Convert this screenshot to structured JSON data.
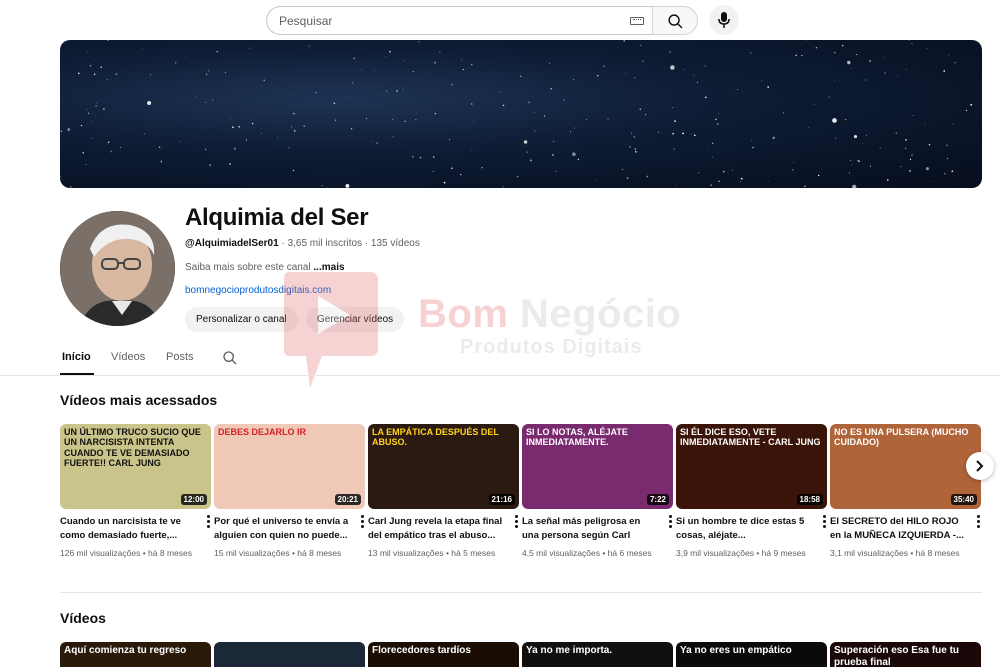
{
  "search": {
    "placeholder": "Pesquisar"
  },
  "icons": {
    "search": "search-icon",
    "keyboard": "keyboard-icon",
    "mic": "mic-icon",
    "more": "more-vert-icon",
    "next": "chevron-right-icon"
  },
  "channel": {
    "title": "Alquimia del Ser",
    "handle": "@AlquimiadelSer01",
    "subscribers": "3,65 mil inscritos",
    "videos_count": "135 vídeos",
    "separator": " · ",
    "about": "Saiba mais sobre este canal",
    "about_more": "...mais",
    "link": "bomnegocioprodutosdigitais.com",
    "customize_label": "Personalizar o canal",
    "manage_label": "Gerenciar vídeos"
  },
  "watermark": {
    "brand_a": "Bom",
    "brand_b": "Negócio",
    "sub": "Produtos Digitais"
  },
  "tabs": [
    {
      "label": "Início"
    },
    {
      "label": "Vídeos"
    },
    {
      "label": "Posts"
    }
  ],
  "popular": {
    "title": "Vídeos mais acessados",
    "videos": [
      {
        "thumb_text": "Un último truco sucio que un narcisista intenta cuando te ve demasiado fuerte!! Carl Jung",
        "duration": "12:00",
        "title": "Cuando un narcisista te ve como demasiado fuerte,...",
        "views": "126 mil visualizações",
        "age": "• há 8 meses",
        "bg": "#c9c48a",
        "fg": "#111111"
      },
      {
        "thumb_text": "Debes dejarlo ir",
        "duration": "20:21",
        "title": "Por qué el universo te envía a alguien con quien no puede...",
        "views": "15 mil visualizações",
        "age": "• há 8 meses",
        "bg": "#f0c8b8",
        "fg": "#d42020"
      },
      {
        "thumb_text": "La empática después del abuso.",
        "duration": "21:16",
        "title": "Carl Jung revela la etapa final del empático tras el abuso...",
        "views": "13 mil visualizações",
        "age": "• há 5 meses",
        "bg": "#2a1a12",
        "fg": "#ffd21e"
      },
      {
        "thumb_text": "Si lo notas, aléjate inmediatamente.",
        "duration": "7:22",
        "title": "La señal más peligrosa en una persona según Carl Jun...",
        "views": "4,5 mil visualizações",
        "age": "• há 6 meses",
        "bg": "#7a2a6e",
        "fg": "#ffffff"
      },
      {
        "thumb_text": "Si él dice eso, vete inmediatamente - Carl Jung",
        "duration": "18:58",
        "title": "Si un hombre te dice estas 5 cosas, aléjate...",
        "views": "3,9 mil visualizações",
        "age": "• há 9 meses",
        "bg": "#3a1408",
        "fg": "#ffffff"
      },
      {
        "thumb_text": "No es una pulsera (mucho cuidado)",
        "duration": "35:40",
        "title": "El SECRETO del HILO ROJO en la MUÑECA IZQUIERDA -...",
        "views": "3,1 mil visualizações",
        "age": "• há 8 meses",
        "bg": "#b0643a",
        "fg": "#ffffff"
      }
    ]
  },
  "videos_section": {
    "title": "Vídeos",
    "thumbs": [
      {
        "text": "Aquí comienza tu regreso",
        "bg": "#2a1a0a",
        "fg": "#ffffff"
      },
      {
        "text": "",
        "bg": "#1a2838",
        "fg": "#ffffff"
      },
      {
        "text": "Florecedores tardíos",
        "bg": "#1a0e04",
        "fg": "#ffffff"
      },
      {
        "text": "Ya no me importa.",
        "bg": "#101010",
        "fg": "#ffffff"
      },
      {
        "text": "Ya no eres un empático",
        "bg": "#0a0a0a",
        "fg": "#ffffff"
      },
      {
        "text": "Superación eso Esa fue tu prueba final",
        "bg": "#1a0808",
        "fg": "#ffffff"
      }
    ]
  }
}
